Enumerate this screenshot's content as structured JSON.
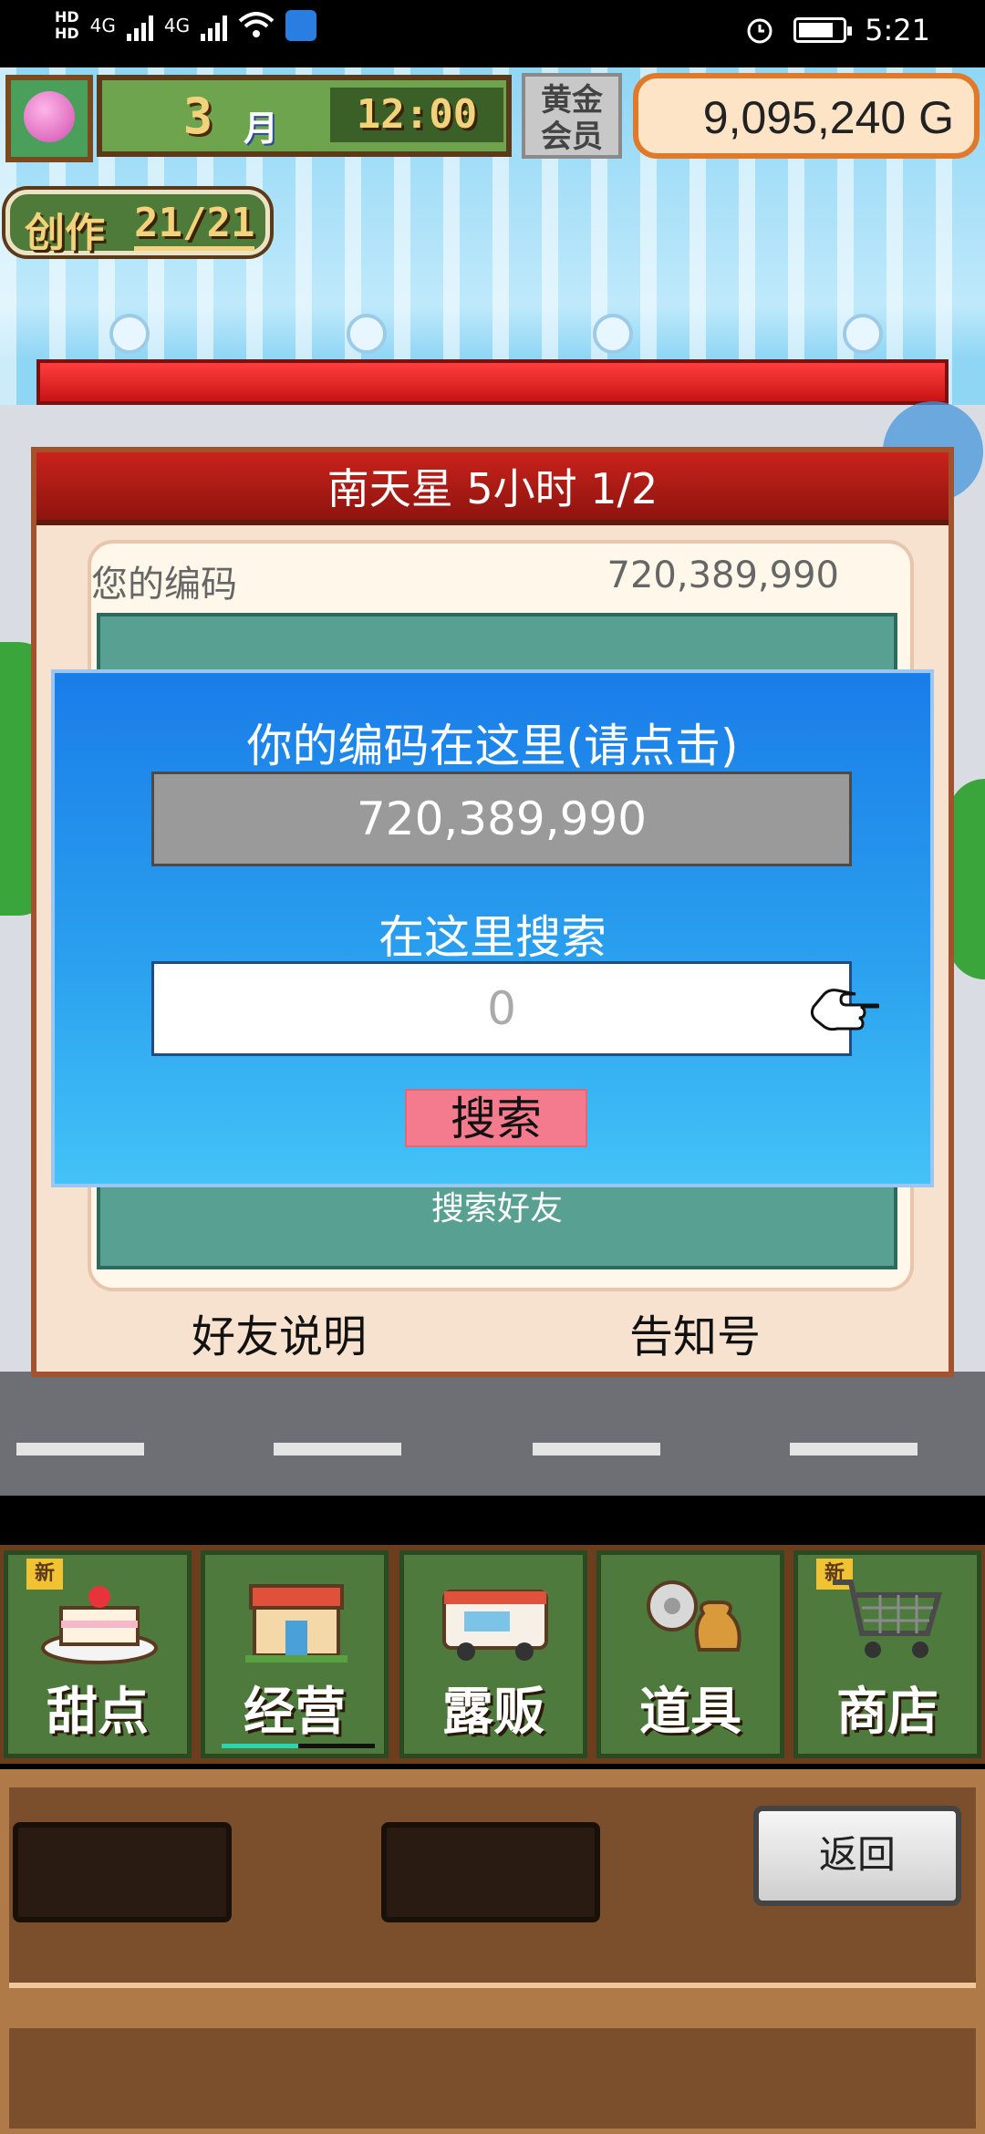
{
  "status_bar": {
    "network_label_top": "HD",
    "network_label_bottom": "HD",
    "signal1_label": "4G",
    "signal2_label": "4G",
    "time": "5:21"
  },
  "hud": {
    "month_number": "3",
    "month_unit": "月",
    "clock": "12:00",
    "gold_member_line1": "黄金",
    "gold_member_line2": "会员",
    "money": "9,095,240 G",
    "create_label": "创作",
    "create_count": "21/21"
  },
  "dialog": {
    "title": "南天星  5小时 1/2",
    "your_code_label": "您的编码",
    "your_code_value": "720,389,990",
    "search_friend_label": "搜索好友",
    "footer_left": "好友说明",
    "footer_right": "告知号"
  },
  "modal": {
    "title": "你的编码在这里(请点击)",
    "code_value": "720,389,990",
    "search_label": "在这里搜索",
    "search_input_placeholder": "0",
    "search_button": "搜索"
  },
  "menu": {
    "new_tag": "新",
    "items": [
      {
        "label": "甜点",
        "icon": "cake-icon",
        "is_new": true
      },
      {
        "label": "经营",
        "icon": "shop-icon",
        "is_new": false,
        "active": true
      },
      {
        "label": "露贩",
        "icon": "food-truck-icon",
        "is_new": false
      },
      {
        "label": "道具",
        "icon": "items-icon",
        "is_new": false
      },
      {
        "label": "商店",
        "icon": "cart-icon",
        "is_new": true
      }
    ],
    "back_button": "返回"
  }
}
